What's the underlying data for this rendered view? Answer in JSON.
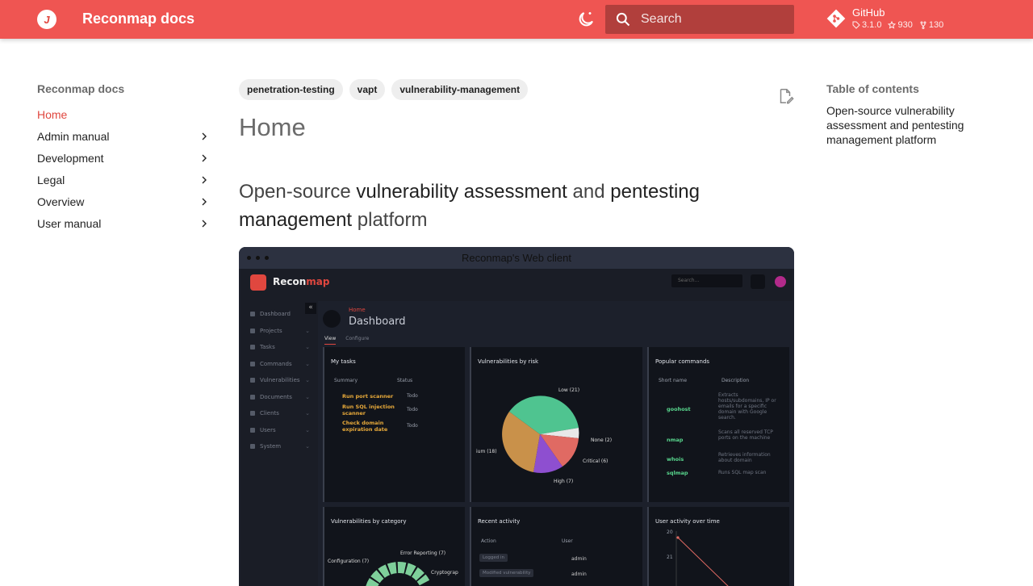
{
  "header": {
    "site_title": "Reconmap docs",
    "logo_glyph": "J",
    "search_placeholder": "Search",
    "repo_name": "GitHub",
    "repo_version": "3.1.0",
    "repo_stars": "930",
    "repo_forks": "130",
    "accent_color": "#ef5552"
  },
  "sidebar": {
    "title": "Reconmap docs",
    "items": [
      {
        "label": "Home",
        "active": true
      },
      {
        "label": "Admin manual"
      },
      {
        "label": "Development"
      },
      {
        "label": "Legal"
      },
      {
        "label": "Overview"
      },
      {
        "label": "User manual"
      }
    ]
  },
  "main": {
    "tags": [
      "penetration-testing",
      "vapt",
      "vulnerability-management"
    ],
    "page_title": "Home",
    "subtitle_parts": [
      "Open-source ",
      "vulnerability assessment",
      " and ",
      "pentesting management",
      " platform"
    ]
  },
  "figure": {
    "caption": "Reconmap's Web client",
    "app_brand_a": "Recon",
    "app_brand_b": "map",
    "app_search": "Search...",
    "side_items": [
      "Dashboard",
      "Projects",
      "Tasks",
      "Commands",
      "Vulnerabilities",
      "Documents",
      "Clients",
      "Users",
      "System"
    ],
    "crumb": "Home",
    "dashboard_title": "Dashboard",
    "tabs": [
      "View",
      "Configure"
    ],
    "my_tasks": {
      "title": "My tasks",
      "col_summary": "Summary",
      "col_status": "Status",
      "rows": [
        {
          "summary": "Run port scanner",
          "status": "Todo"
        },
        {
          "summary": "Run SQL injection scanner",
          "status": "Todo"
        },
        {
          "summary": "Check domain expiration date",
          "status": "Todo"
        }
      ]
    },
    "vuln_risk": {
      "title": "Vulnerabilities by risk",
      "labels": [
        "Low (21)",
        "None (2)",
        "Critical (6)",
        "High (7)",
        "ium (18)"
      ]
    },
    "popular_commands": {
      "title": "Popular commands",
      "col_name": "Short name",
      "col_desc": "Description",
      "rows": [
        {
          "name": "goohost",
          "desc": "Extracts hosts/subdomains, IP or emails for a specific domain with Google search."
        },
        {
          "name": "nmap",
          "desc": "Scans all reserved TCP ports on the machine"
        },
        {
          "name": "whois",
          "desc": "Retrieves information about domain"
        },
        {
          "name": "sqlmap",
          "desc": "Runs SQL map scan"
        }
      ]
    },
    "vuln_category": {
      "title": "Vulnerabilities by category",
      "labels": [
        "Error Reporting (7)",
        "Configuration (7)",
        "Cryptograp"
      ]
    },
    "recent_activity": {
      "title": "Recent activity",
      "col_action": "Action",
      "col_user": "User",
      "rows": [
        {
          "action": "Logged in",
          "user": "admin"
        },
        {
          "action": "Modified vulnerability",
          "user": "admin"
        }
      ]
    },
    "user_activity": {
      "title": "User activity over time",
      "ticks": [
        "20",
        "21"
      ]
    }
  },
  "toc": {
    "title": "Table of contents",
    "link": "Open-source vulnerability assessment and pentesting management platform"
  }
}
